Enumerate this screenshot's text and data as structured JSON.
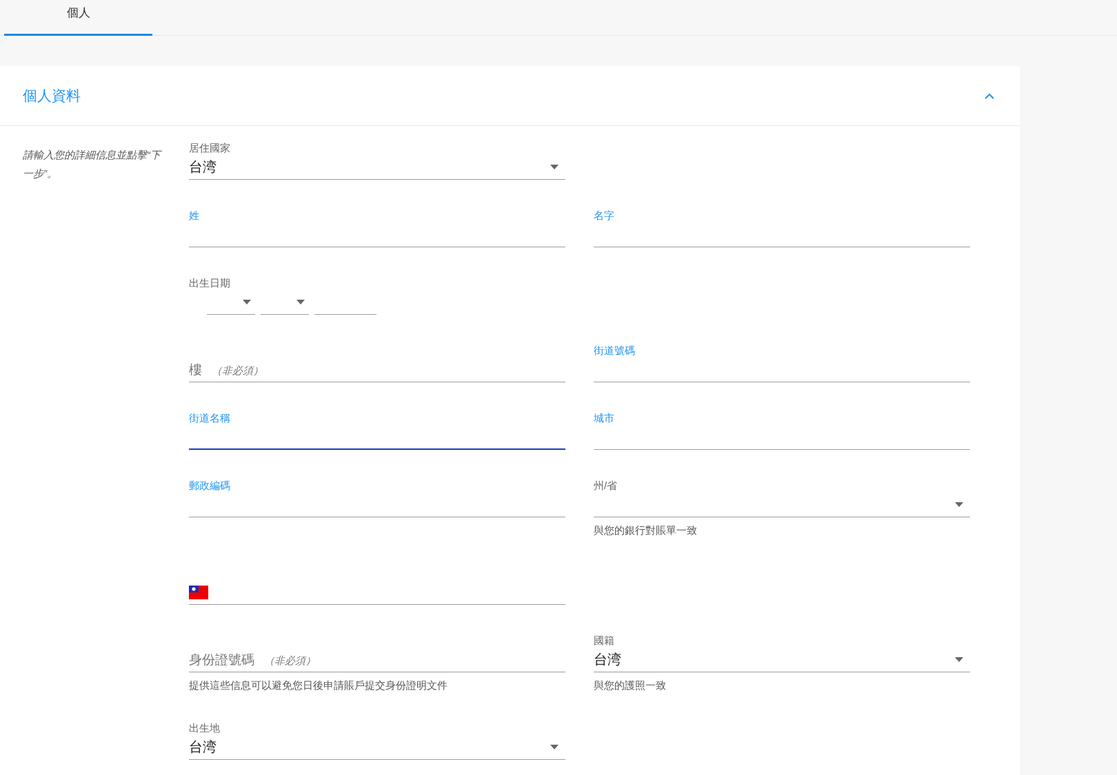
{
  "tabs": [
    {
      "label": "個人",
      "selected": true
    }
  ],
  "section": {
    "title": "個人資料",
    "expanded": true,
    "hint": "請輸入您的詳細信息並點擊“下一步”。",
    "rows": [
      [
        {
          "kind": "select",
          "label": "居住國家",
          "value": "台湾"
        }
      ],
      [
        {
          "kind": "text",
          "label": "姓",
          "focused": false
        },
        {
          "kind": "text",
          "label": "名字",
          "focused": false
        }
      ],
      [
        {
          "kind": "date",
          "label": "出生日期"
        }
      ],
      [
        {
          "kind": "text",
          "placeholder": "樓 *（非必須）*",
          "focused": false
        },
        {
          "kind": "text",
          "label": "街道號碼",
          "focused": false
        }
      ],
      [
        {
          "kind": "text",
          "label": "街道名稱",
          "focused": true
        },
        {
          "kind": "text",
          "label": "城市",
          "focused": false
        }
      ],
      [
        {
          "kind": "text",
          "label": "郵政編碼",
          "focused": false
        },
        {
          "kind": "select",
          "label": "州/省",
          "helper": "與您的銀行對賬單一致"
        }
      ],
      [
        {
          "kind": "phone"
        }
      ],
      [
        {
          "kind": "text",
          "placeholder": "身份證號碼 *（非必須）*",
          "focused": false,
          "helper": "提供這些信息可以避免您日後申請賬戶提交身份證明文件"
        },
        {
          "kind": "select",
          "label": "國籍",
          "value": "台湾",
          "helper": "與您的護照一致"
        }
      ],
      [
        {
          "kind": "select",
          "label": "出生地",
          "value": "台湾"
        }
      ]
    ]
  }
}
